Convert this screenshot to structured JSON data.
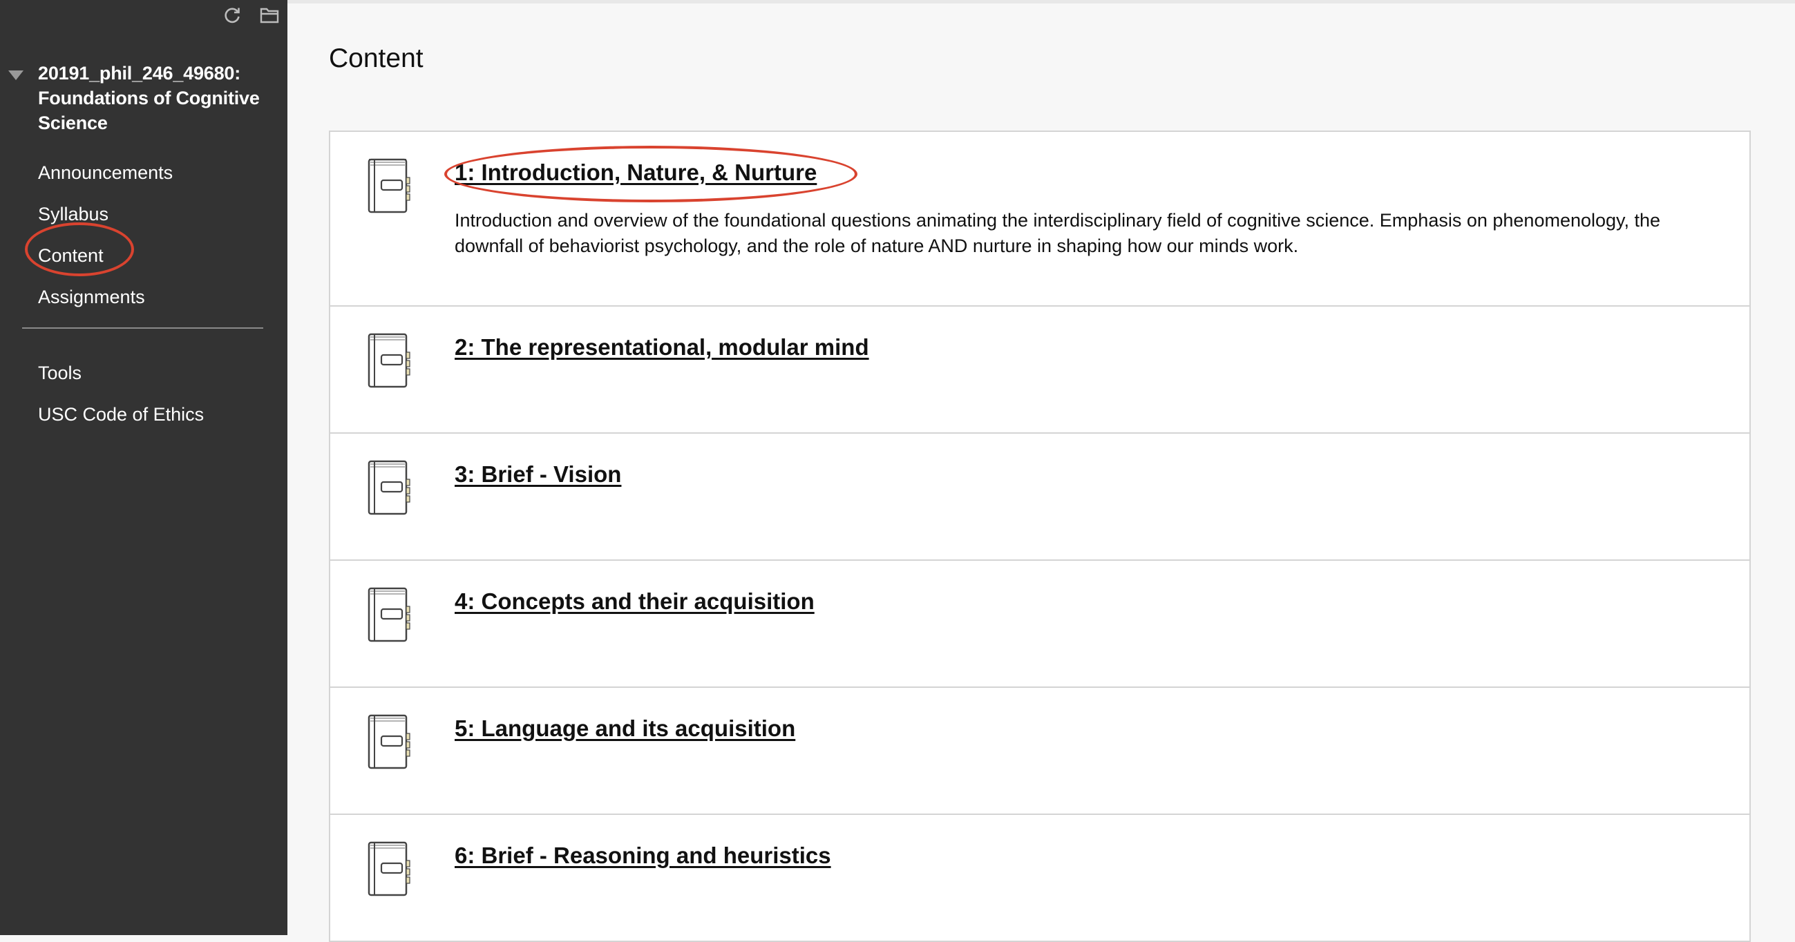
{
  "sidebar": {
    "tools": [
      {
        "icon": "refresh-icon"
      },
      {
        "icon": "folder-icon"
      }
    ],
    "course_title": "20191_phil_246_49680: Foundations of Cognitive Science",
    "primary_nav": [
      {
        "label": "Announcements"
      },
      {
        "label": "Syllabus"
      },
      {
        "label": "Content"
      },
      {
        "label": "Assignments"
      }
    ],
    "secondary_nav": [
      {
        "label": "Tools"
      },
      {
        "label": "USC Code of Ethics"
      }
    ]
  },
  "main": {
    "page_title": "Content",
    "items": [
      {
        "title": "1: Introduction, Nature, & Nurture",
        "description": "Introduction and overview of the foundational questions animating the interdisciplinary field of cognitive science. Emphasis on phenomenology, the downfall of behaviorist psychology, and the role of nature AND nurture in shaping how our minds work.",
        "icon": "notebook-icon"
      },
      {
        "title": "2: The representational, modular mind",
        "icon": "notebook-icon"
      },
      {
        "title": "3: Brief - Vision",
        "icon": "notebook-icon"
      },
      {
        "title": "4: Concepts and their acquisition",
        "icon": "notebook-icon"
      },
      {
        "title": "5: Language and its acquisition",
        "icon": "notebook-icon"
      },
      {
        "title": "6: Brief - Reasoning and heuristics",
        "icon": "notebook-icon"
      }
    ]
  },
  "colors": {
    "sidebar_bg": "#333333",
    "annotation_circle": "#d9432f",
    "page_bg": "#f7f7f7"
  }
}
